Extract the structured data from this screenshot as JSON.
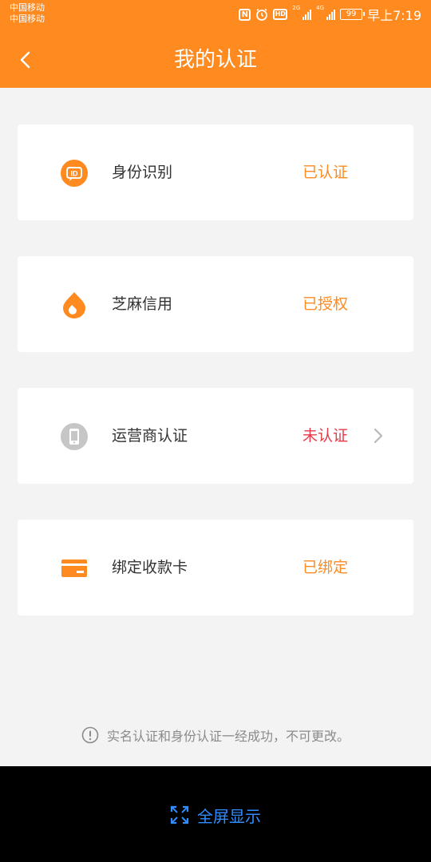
{
  "status_bar": {
    "carrier_1": "中国移动",
    "carrier_2": "中国移动",
    "nfc": "N",
    "hd": "HD",
    "net_1": "2G",
    "net_2": "4G",
    "battery": "99",
    "time": "早上7:19"
  },
  "header": {
    "title": "我的认证",
    "back_icon": "chevron-left-icon"
  },
  "items": [
    {
      "label": "身份识别",
      "status": "已认证",
      "icon": "id-icon",
      "status_color": "#ff8a1f"
    },
    {
      "label": "芝麻信用",
      "status": "已授权",
      "icon": "sesame-credit-icon",
      "status_color": "#ff8a1f"
    },
    {
      "label": "运营商认证",
      "status": "未认证",
      "icon": "phone-icon",
      "status_color": "#e8394a"
    },
    {
      "label": "绑定收款卡",
      "status": "已绑定",
      "icon": "card-icon",
      "status_color": "#ff8a1f"
    }
  ],
  "notice": {
    "text": "实名认证和身份认证一经成功，不可更改。",
    "icon": "info-icon"
  },
  "bottom_bar": {
    "label": "全屏显示",
    "icon": "expand-icon"
  },
  "colors": {
    "accent": "#ff8a1f",
    "warning": "#e8394a",
    "background": "#f3f3f3",
    "fullscreen_text": "#2f8dff"
  }
}
